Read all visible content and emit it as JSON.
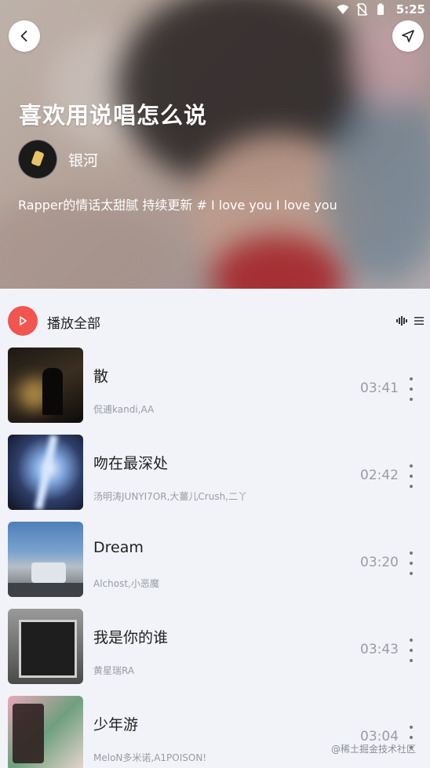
{
  "status": {
    "time": "5:25"
  },
  "header": {
    "title": "喜欢用说唱怎么说",
    "creator": "银河",
    "description": "Rapper的情话太甜腻 持续更新 # I love you I love you"
  },
  "actions": {
    "play_all_label": "播放全部"
  },
  "songs": [
    {
      "title": "散",
      "artist": "侃逋kandi,AA",
      "duration": "03:41"
    },
    {
      "title": "吻在最深处",
      "artist": "汤明涛JUNYI7OR,大薑儿Crush,二丫",
      "duration": "02:42"
    },
    {
      "title": "Dream",
      "artist": "Alchost,小恶魔",
      "duration": "03:20"
    },
    {
      "title": "我是你的谁",
      "artist": "黄星瑞RA",
      "duration": "03:43"
    },
    {
      "title": "少年游",
      "artist": "MeloN多米诺,A1POISON!",
      "duration": "03:04"
    }
  ],
  "watermark": "@稀土掘金技术社区",
  "colors": {
    "accent": "#f1554f",
    "background": "#f1f3f9"
  }
}
